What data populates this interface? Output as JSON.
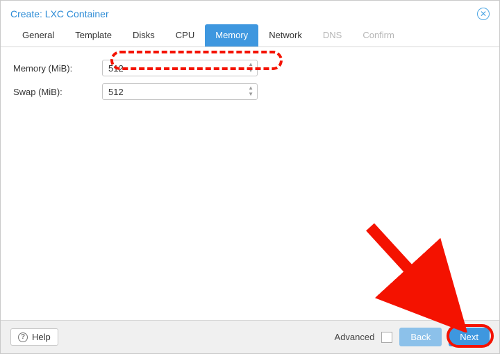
{
  "title": "Create: LXC Container",
  "tabs": {
    "general": "General",
    "template": "Template",
    "disks": "Disks",
    "cpu": "CPU",
    "memory": "Memory",
    "network": "Network",
    "dns": "DNS",
    "confirm": "Confirm"
  },
  "fields": {
    "memory_label": "Memory (MiB):",
    "memory_value": "512",
    "swap_label": "Swap (MiB):",
    "swap_value": "512"
  },
  "footer": {
    "help": "Help",
    "advanced": "Advanced",
    "back": "Back",
    "next": "Next"
  }
}
